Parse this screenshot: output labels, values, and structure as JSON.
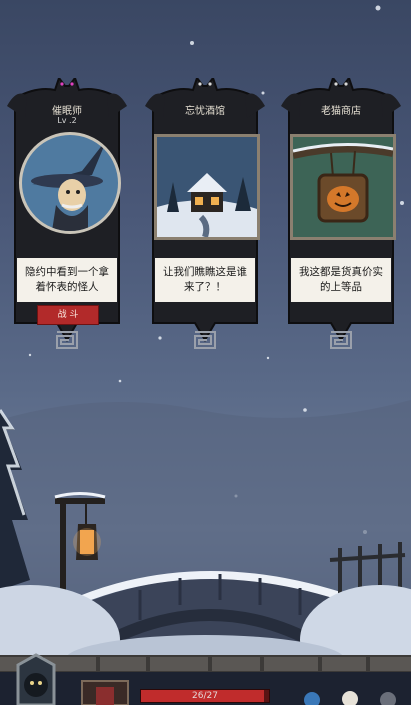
{
  "cards": [
    {
      "title": "催眠师",
      "level": "Lv .2",
      "desc": "隐约中看到一个拿着怀表的怪人",
      "action": "战 斗"
    },
    {
      "title": "忘忧酒馆",
      "desc": "让我们瞧瞧这是谁来了？！"
    },
    {
      "title": "老猫商店",
      "desc": "我这都是货真价实的上等品"
    }
  ],
  "hud": {
    "hp_text": "26/27",
    "hp_fraction": 0.963
  },
  "colors": {
    "accent_red": "#b22a2a",
    "card_dark": "#1e1f24",
    "desc_bg": "#f4f1ea"
  }
}
